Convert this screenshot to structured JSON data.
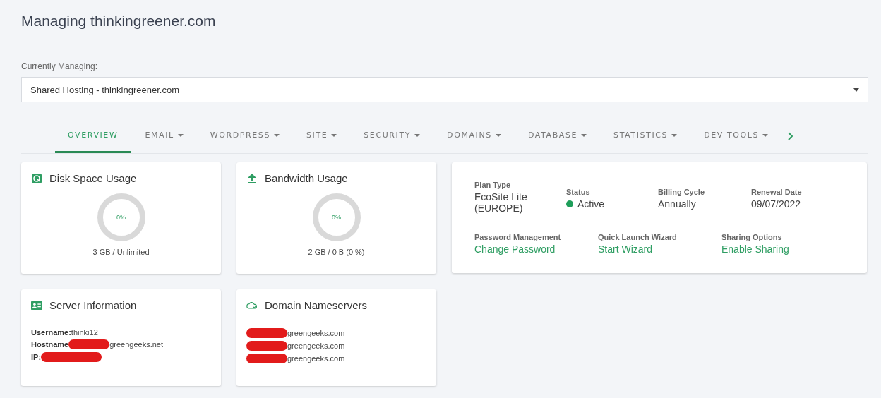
{
  "page_title": "Managing thinkingreener.com",
  "selector": {
    "label": "Currently Managing:",
    "value": "Shared Hosting - thinkingreener.com"
  },
  "tabs": [
    {
      "label": "OVERVIEW",
      "selected": true,
      "menu": false
    },
    {
      "label": "EMAIL",
      "selected": false,
      "menu": true
    },
    {
      "label": "WORDPRESS",
      "selected": false,
      "menu": true
    },
    {
      "label": "SITE",
      "selected": false,
      "menu": true
    },
    {
      "label": "SECURITY",
      "selected": false,
      "menu": true
    },
    {
      "label": "DOMAINS",
      "selected": false,
      "menu": true
    },
    {
      "label": "DATABASE",
      "selected": false,
      "menu": true
    },
    {
      "label": "STATISTICS",
      "selected": false,
      "menu": true
    },
    {
      "label": "DEV TOOLS",
      "selected": false,
      "menu": true
    }
  ],
  "usage_cards": [
    {
      "title": "Disk Space Usage",
      "percent": "0%",
      "detail": "3 GB / Unlimited"
    },
    {
      "title": "Bandwidth Usage",
      "percent": "0%",
      "detail": "2 GB / 0 B (0 %)"
    }
  ],
  "plan": {
    "fields": [
      {
        "label": "Plan Type",
        "value": "EcoSite Lite (EUROPE)"
      },
      {
        "label": "Status",
        "value": "Active",
        "color": "#1e9e5a"
      },
      {
        "label": "Billing Cycle",
        "value": "Annually"
      },
      {
        "label": "Renewal Date",
        "value": "09/07/2022"
      }
    ],
    "actions": [
      {
        "label": "Password Management",
        "link": "Change Password"
      },
      {
        "label": "Quick Launch Wizard",
        "link": "Start Wizard"
      },
      {
        "label": "Sharing Options",
        "link": "Enable Sharing"
      }
    ]
  },
  "info_cards": [
    {
      "title": "Server Information",
      "lines": [
        {
          "label": "Username:",
          "value": "thinki12",
          "redacted": false
        },
        {
          "label": "Hostname",
          "value": "greengeeks.net",
          "redacted": true
        },
        {
          "label": "IP:",
          "redacted": true
        }
      ]
    },
    {
      "title": "Domain Nameservers",
      "lines": [
        {
          "value": "greengeeks.com",
          "redacted": true
        },
        {
          "value": "greengeeks.com",
          "redacted": true
        },
        {
          "value": "greengeeks.com",
          "redacted": true
        }
      ]
    }
  ]
}
